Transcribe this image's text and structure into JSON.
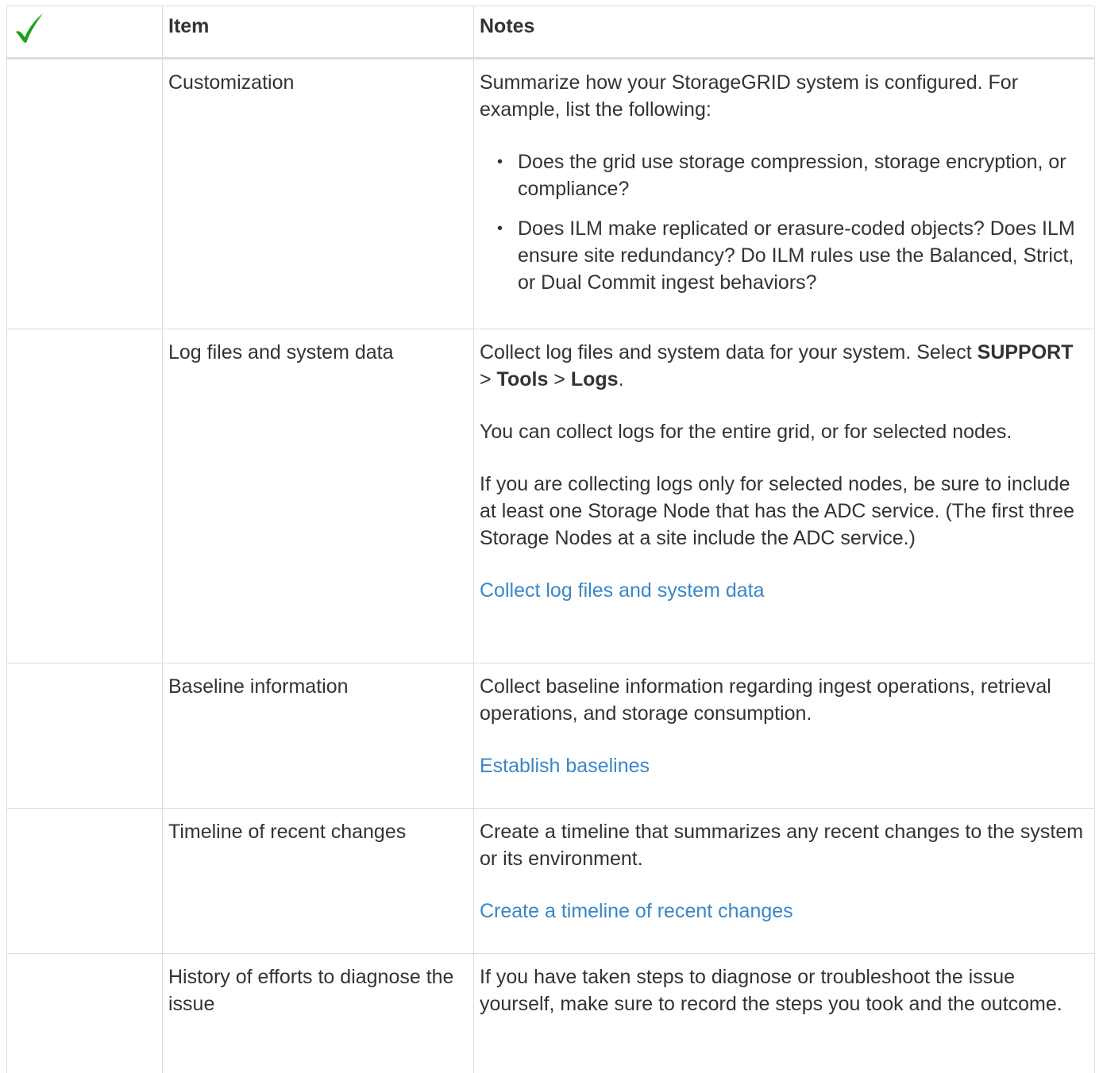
{
  "header": {
    "check_icon": "green-checkmark-icon",
    "check_color": "#1aa41a",
    "item_label": "Item",
    "notes_label": "Notes"
  },
  "link_color": "#3a87c8",
  "rows": [
    {
      "item": "Customization",
      "intro": "Summarize how your StorageGRID system is configured. For example, list the following:",
      "bullets": [
        "Does the grid use storage compression, storage encryption, or compliance?",
        "Does ILM make replicated or erasure-coded objects? Does ILM ensure site redundancy? Do ILM rules use the Balanced, Strict, or Dual Commit ingest behaviors?"
      ]
    },
    {
      "item": "Log files and system data",
      "p1_text": "Collect log files and system data for your system. Select ",
      "menu_1": "SUPPORT",
      "sep_1": " > ",
      "menu_2": "Tools",
      "sep_2": " > ",
      "menu_3": "Logs",
      "p1_end": ".",
      "p2": "You can collect logs for the entire grid, or for selected nodes.",
      "p3": "If you are collecting logs only for selected nodes, be sure to include at least one Storage Node that has the ADC service. (The first three Storage Nodes at a site include the ADC service.)",
      "link": "Collect log files and system data"
    },
    {
      "item": "Baseline information",
      "p1": "Collect baseline information regarding ingest operations, retrieval operations, and storage consumption.",
      "link": "Establish baselines"
    },
    {
      "item": "Timeline of recent changes",
      "p1": "Create a timeline that summarizes any recent changes to the system or its environment.",
      "link": "Create a timeline of recent changes"
    },
    {
      "item": "History of efforts to diagnose the issue",
      "p1": "If you have taken steps to diagnose or troubleshoot the issue yourself, make sure to record the steps you took and the outcome."
    }
  ]
}
